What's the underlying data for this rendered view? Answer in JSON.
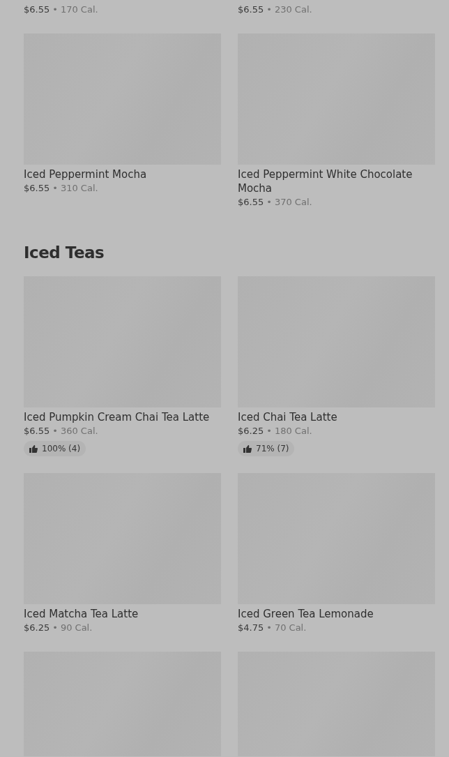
{
  "sections": [
    {
      "items": [
        {
          "kind": "price-only",
          "price": "$6.55",
          "separator": "•",
          "calories": "170 Cal."
        },
        {
          "kind": "price-only",
          "price": "$6.55",
          "separator": "•",
          "calories": "230 Cal."
        },
        {
          "kind": "full",
          "name": "Iced Peppermint Mocha",
          "price": "$6.55",
          "separator": "•",
          "calories": "310 Cal."
        },
        {
          "kind": "full",
          "name": "Iced Peppermint White Chocolate Mocha",
          "price": "$6.55",
          "separator": "•",
          "calories": "370 Cal."
        }
      ]
    },
    {
      "title": "Iced Teas",
      "items": [
        {
          "kind": "full",
          "name": "Iced Pumpkin Cream Chai Tea Latte",
          "price": "$6.55",
          "separator": "•",
          "calories": "360 Cal.",
          "rating": "100% (4)"
        },
        {
          "kind": "full",
          "name": "Iced Chai Tea Latte",
          "price": "$6.25",
          "separator": "•",
          "calories": "180 Cal.",
          "rating": "71% (7)"
        },
        {
          "kind": "full",
          "name": "Iced Matcha Tea Latte",
          "price": "$6.25",
          "separator": "•",
          "calories": "90 Cal."
        },
        {
          "kind": "full",
          "name": "Iced Green Tea Lemonade",
          "price": "$4.75",
          "separator": "•",
          "calories": "70 Cal."
        },
        {
          "kind": "image-only"
        },
        {
          "kind": "image-only"
        }
      ]
    }
  ]
}
